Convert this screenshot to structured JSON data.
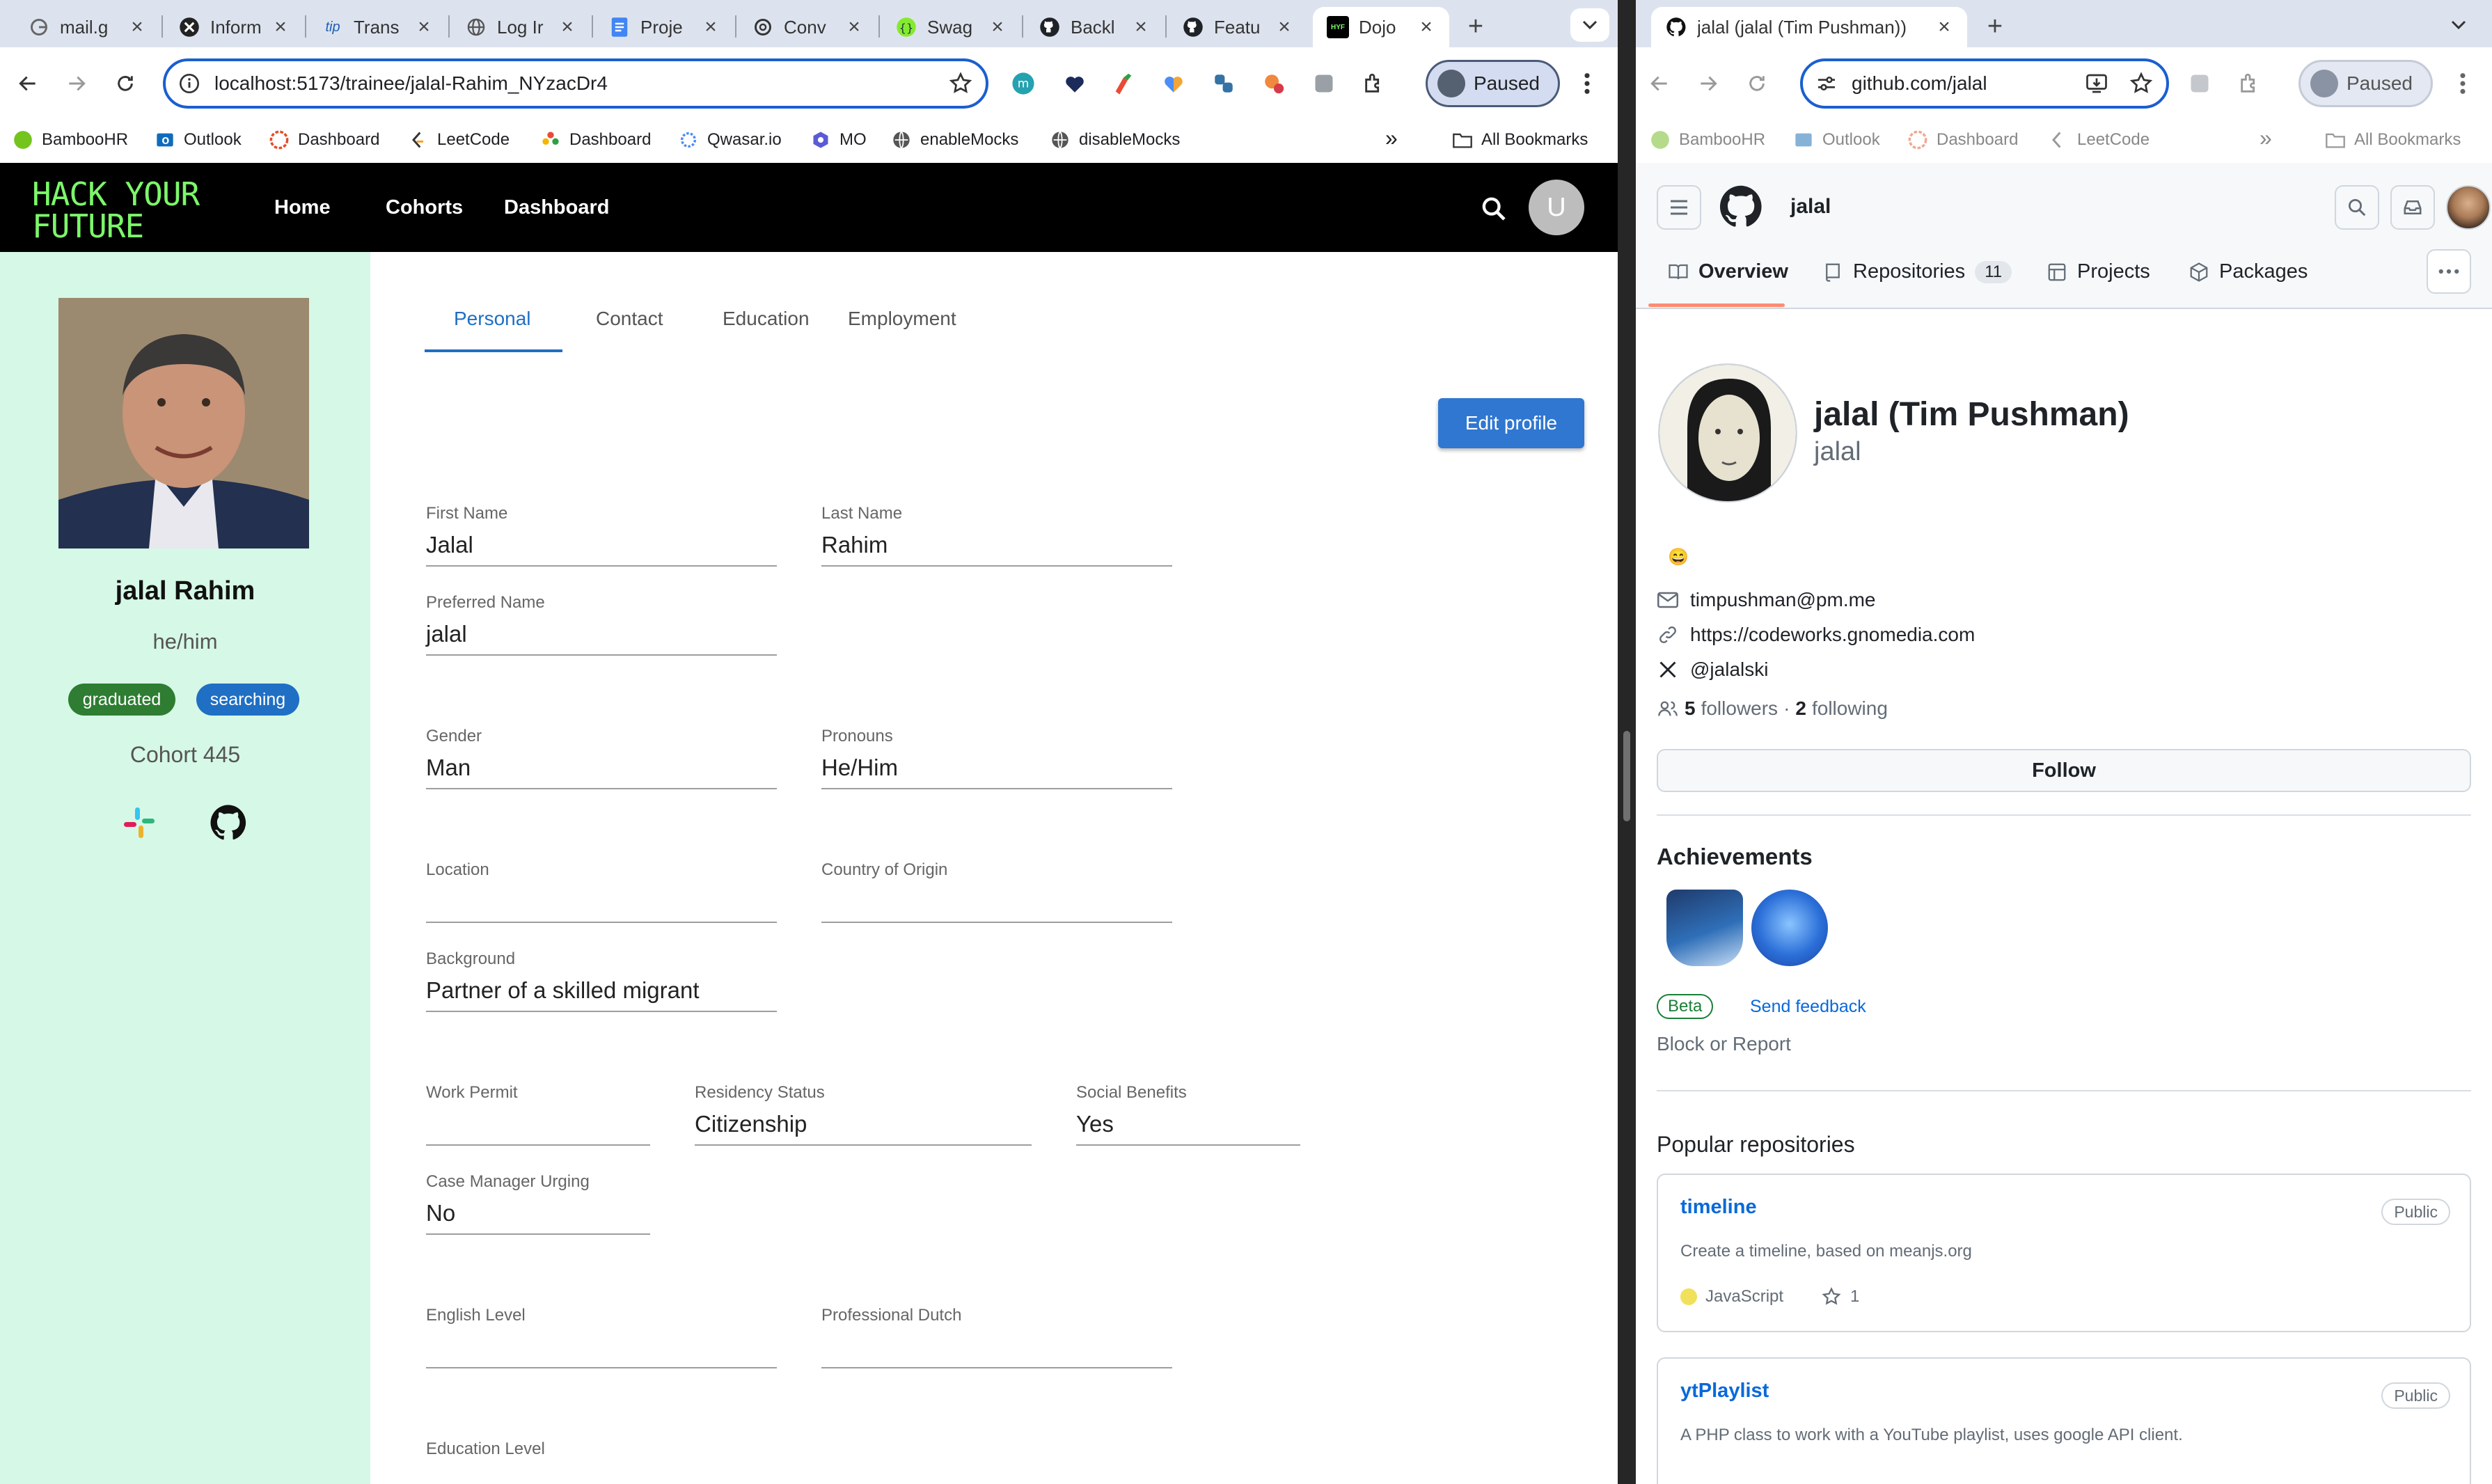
{
  "left_browser": {
    "tabs": [
      {
        "title": "mail.g",
        "icon": "google-icon"
      },
      {
        "title": "Inform",
        "icon": "x-circle-icon"
      },
      {
        "title": "Trans",
        "icon": "tip-icon"
      },
      {
        "title": "Log Ir",
        "icon": "globe-icon"
      },
      {
        "title": "Proje",
        "icon": "docs-icon"
      },
      {
        "title": "Conv",
        "icon": "chatgpt-icon"
      },
      {
        "title": "Swag",
        "icon": "swagger-icon"
      },
      {
        "title": "Backl",
        "icon": "github-icon"
      },
      {
        "title": "Featu",
        "icon": "github-icon"
      },
      {
        "title": "Dojo",
        "icon": "hyf-icon"
      }
    ],
    "url_host": "localhost",
    "url_rest": ":5173/trainee/jalal-Rahim_NYzacDr4",
    "profile_label": "Paused",
    "bookmarks": [
      "BambooHR",
      "Outlook",
      "Dashboard",
      "LeetCode",
      "Dashboard",
      "Qwasar.io",
      "MO",
      "enableMocks",
      "disableMocks"
    ],
    "all_bookmarks": "All Bookmarks",
    "overflow": "»"
  },
  "hyf": {
    "logo_line1": "HACK YOUR",
    "logo_line2": "FUTURE",
    "nav": [
      "Home",
      "Cohorts",
      "Dashboard"
    ],
    "avatar_letter": "U",
    "brand_color": "#7cf76a"
  },
  "profile": {
    "name": "jalal Rahim",
    "pronouns": "he/him",
    "chip_graduated": "graduated",
    "chip_searching": "searching",
    "cohort": "Cohort 445"
  },
  "form": {
    "tabs": [
      "Personal",
      "Contact",
      "Education",
      "Employment"
    ],
    "edit_button": "Edit profile",
    "fields": {
      "first_name": {
        "label": "First Name",
        "value": "Jalal"
      },
      "last_name": {
        "label": "Last Name",
        "value": "Rahim"
      },
      "preferred_name": {
        "label": "Preferred Name",
        "value": "jalal"
      },
      "gender": {
        "label": "Gender",
        "value": "Man"
      },
      "pronouns": {
        "label": "Pronouns",
        "value": "He/Him"
      },
      "location": {
        "label": "Location",
        "value": ""
      },
      "country": {
        "label": "Country of Origin",
        "value": ""
      },
      "background": {
        "label": "Background",
        "value": "Partner of a skilled migrant"
      },
      "work_permit": {
        "label": "Work Permit",
        "value": ""
      },
      "residency": {
        "label": "Residency Status",
        "value": "Citizenship"
      },
      "social_benefits": {
        "label": "Social Benefits",
        "value": "Yes"
      },
      "case_manager": {
        "label": "Case Manager Urging",
        "value": "No"
      },
      "english": {
        "label": "English Level",
        "value": ""
      },
      "dutch": {
        "label": "Professional Dutch",
        "value": ""
      },
      "education_level": {
        "label": "Education Level",
        "value": ""
      }
    }
  },
  "right_browser": {
    "tab_title": "jalal (jalal (Tim Pushman))",
    "url": "github.com/jalal",
    "profile_label": "Paused",
    "bookmarks": [
      "BambooHR",
      "Outlook",
      "Dashboard",
      "LeetCode"
    ],
    "all_bookmarks": "All Bookmarks",
    "overflow": "»"
  },
  "github": {
    "header_user": "jalal",
    "tabs": {
      "overview": "Overview",
      "repositories": "Repositories",
      "repo_count": "11",
      "projects": "Projects",
      "packages": "Packages"
    },
    "display_name": "jalal (Tim Pushman)",
    "login": "jalal",
    "status_emoji": "😄",
    "email": "timpushman@pm.me",
    "website": "https://codeworks.gnomedia.com",
    "twitter": "@jalalski",
    "followers_count": "5",
    "followers_label": "followers",
    "separator": "·",
    "following_count": "2",
    "following_label": "following",
    "follow_button": "Follow",
    "achievements_title": "Achievements",
    "beta_label": "Beta",
    "send_feedback": "Send feedback",
    "block_report": "Block or Report",
    "popular_title": "Popular repositories",
    "repos": [
      {
        "name": "timeline",
        "visibility": "Public",
        "description": "Create a timeline, based on meanjs.org",
        "language": "JavaScript",
        "stars": "1"
      },
      {
        "name": "ytPlaylist",
        "visibility": "Public",
        "description": "A PHP class to work with a YouTube playlist, uses google API client."
      }
    ]
  }
}
